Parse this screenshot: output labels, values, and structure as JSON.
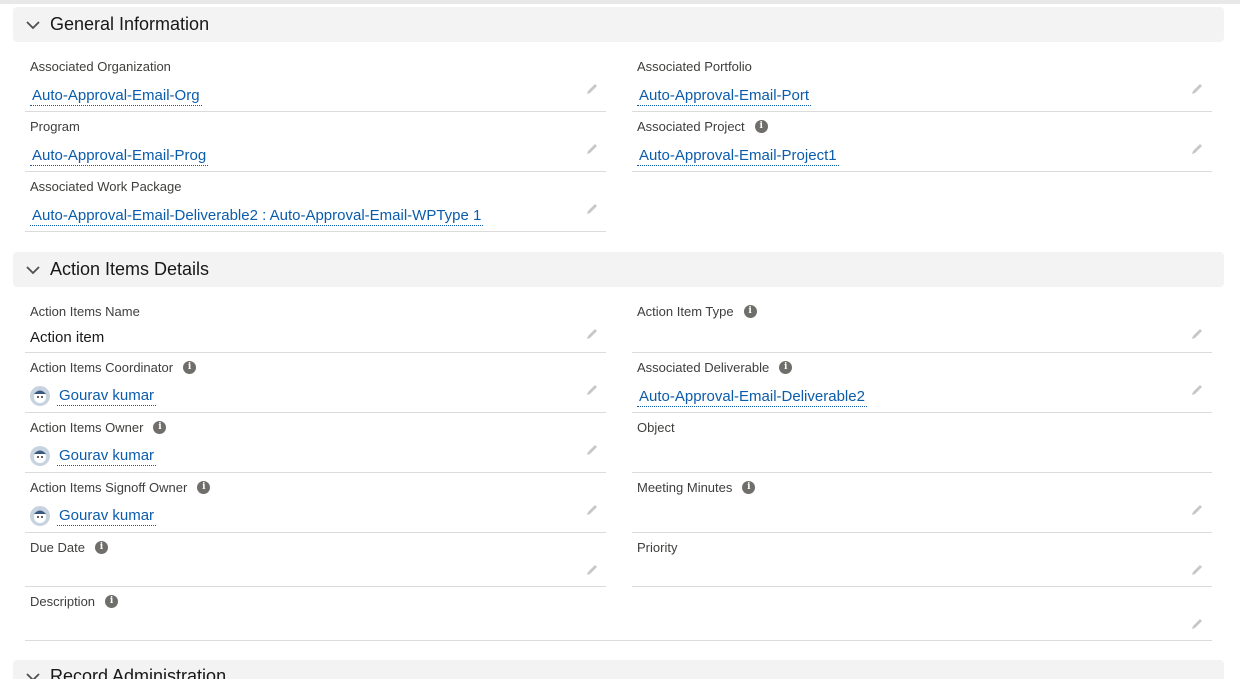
{
  "sections": {
    "general": {
      "title": "General Information"
    },
    "action": {
      "title": "Action Items Details"
    },
    "admin": {
      "title": "Record Administration"
    }
  },
  "general": {
    "associated_organization": {
      "label": "Associated Organization",
      "value": "Auto-Approval-Email-Org"
    },
    "associated_portfolio": {
      "label": "Associated Portfolio",
      "value": "Auto-Approval-Email-Port"
    },
    "program": {
      "label": "Program",
      "value": "Auto-Approval-Email-Prog"
    },
    "associated_project": {
      "label": "Associated Project",
      "value": "Auto-Approval-Email-Project1"
    },
    "associated_work_package": {
      "label": "Associated Work Package",
      "value": "Auto-Approval-Email-Deliverable2 : Auto-Approval-Email-WPType 1"
    }
  },
  "action": {
    "name": {
      "label": "Action Items Name",
      "value": "Action item"
    },
    "type": {
      "label": "Action Item Type",
      "value": ""
    },
    "coordinator": {
      "label": "Action Items Coordinator",
      "value": "Gourav kumar"
    },
    "deliverable": {
      "label": "Associated Deliverable",
      "value": "Auto-Approval-Email-Deliverable2"
    },
    "owner": {
      "label": "Action Items Owner",
      "value": "Gourav kumar"
    },
    "object": {
      "label": "Object",
      "value": ""
    },
    "signoff_owner": {
      "label": "Action Items Signoff Owner",
      "value": "Gourav kumar"
    },
    "meeting_minutes": {
      "label": "Meeting Minutes",
      "value": ""
    },
    "due_date": {
      "label": "Due Date",
      "value": ""
    },
    "priority": {
      "label": "Priority",
      "value": ""
    },
    "description": {
      "label": "Description",
      "value": ""
    }
  },
  "icons": {
    "chevron": "chevron-down-icon",
    "edit": "pencil-icon",
    "info": "info-icon",
    "avatar": "user-avatar-icon"
  },
  "colors": {
    "link": "#0b5cab",
    "section_bg": "#f3f3f3",
    "divider": "#dddbda",
    "icon_gray": "#706e6b"
  }
}
